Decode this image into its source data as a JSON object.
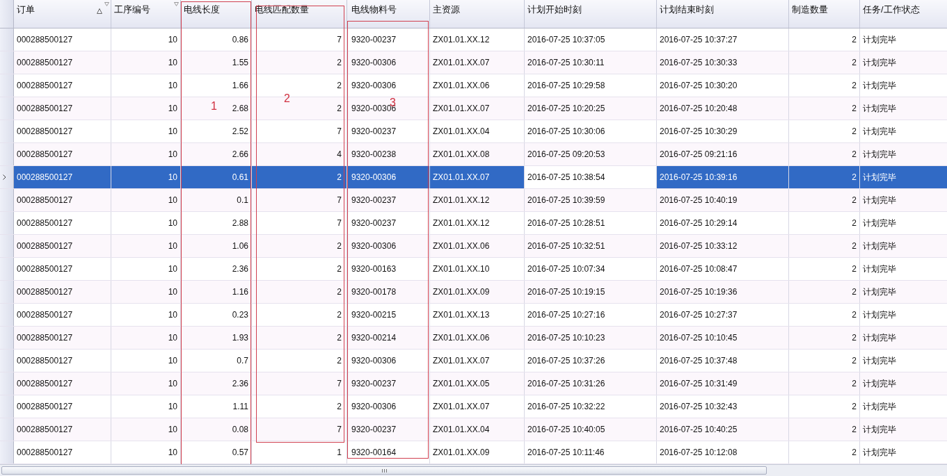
{
  "table": {
    "columns": [
      {
        "label": "订单",
        "kind": "text",
        "sort_ascending": true,
        "filter": true,
        "focused": false
      },
      {
        "label": "工序编号",
        "kind": "number",
        "sort_ascending": false,
        "filter": true,
        "focused": false
      },
      {
        "label": "电线长度",
        "kind": "number",
        "sort_ascending": false,
        "filter": false,
        "focused": false
      },
      {
        "label": "电线匹配数量",
        "kind": "number",
        "sort_ascending": false,
        "filter": false,
        "focused": false
      },
      {
        "label": "电线物料号",
        "kind": "text",
        "sort_ascending": false,
        "filter": false,
        "focused": false
      },
      {
        "label": "主资源",
        "kind": "text",
        "sort_ascending": false,
        "filter": false,
        "focused": false
      },
      {
        "label": "计划开始时刻",
        "kind": "text",
        "sort_ascending": false,
        "filter": false,
        "focused": true
      },
      {
        "label": "计划结束时刻",
        "kind": "text",
        "sort_ascending": false,
        "filter": false,
        "focused": false
      },
      {
        "label": "制造数量",
        "kind": "number",
        "sort_ascending": false,
        "filter": false,
        "focused": false
      },
      {
        "label": "任务/工作状态",
        "kind": "text",
        "sort_ascending": false,
        "filter": false,
        "focused": false
      }
    ],
    "rows": [
      {
        "selected": false,
        "cells": [
          "000288500127",
          "10",
          "0.86",
          "7",
          "9320-00237",
          "ZX01.01.XX.12",
          "2016-07-25 10:37:05",
          "2016-07-25 10:37:27",
          "2",
          "计划完毕"
        ]
      },
      {
        "selected": false,
        "cells": [
          "000288500127",
          "10",
          "1.55",
          "2",
          "9320-00306",
          "ZX01.01.XX.07",
          "2016-07-25 10:30:11",
          "2016-07-25 10:30:33",
          "2",
          "计划完毕"
        ]
      },
      {
        "selected": false,
        "cells": [
          "000288500127",
          "10",
          "1.66",
          "2",
          "9320-00306",
          "ZX01.01.XX.06",
          "2016-07-25 10:29:58",
          "2016-07-25 10:30:20",
          "2",
          "计划完毕"
        ]
      },
      {
        "selected": false,
        "cells": [
          "000288500127",
          "10",
          "2.68",
          "2",
          "9320-00306",
          "ZX01.01.XX.07",
          "2016-07-25 10:20:25",
          "2016-07-25 10:20:48",
          "2",
          "计划完毕"
        ]
      },
      {
        "selected": false,
        "cells": [
          "000288500127",
          "10",
          "2.52",
          "7",
          "9320-00237",
          "ZX01.01.XX.04",
          "2016-07-25 10:30:06",
          "2016-07-25 10:30:29",
          "2",
          "计划完毕"
        ]
      },
      {
        "selected": false,
        "cells": [
          "000288500127",
          "10",
          "2.66",
          "4",
          "9320-00238",
          "ZX01.01.XX.08",
          "2016-07-25 09:20:53",
          "2016-07-25 09:21:16",
          "2",
          "计划完毕"
        ]
      },
      {
        "selected": true,
        "cells": [
          "000288500127",
          "10",
          "0.61",
          "2",
          "9320-00306",
          "ZX01.01.XX.07",
          "2016-07-25 10:38:54",
          "2016-07-25 10:39:16",
          "2",
          "计划完毕"
        ]
      },
      {
        "selected": false,
        "cells": [
          "000288500127",
          "10",
          "0.1",
          "7",
          "9320-00237",
          "ZX01.01.XX.12",
          "2016-07-25 10:39:59",
          "2016-07-25 10:40:19",
          "2",
          "计划完毕"
        ]
      },
      {
        "selected": false,
        "cells": [
          "000288500127",
          "10",
          "2.88",
          "7",
          "9320-00237",
          "ZX01.01.XX.12",
          "2016-07-25 10:28:51",
          "2016-07-25 10:29:14",
          "2",
          "计划完毕"
        ]
      },
      {
        "selected": false,
        "cells": [
          "000288500127",
          "10",
          "1.06",
          "2",
          "9320-00306",
          "ZX01.01.XX.06",
          "2016-07-25 10:32:51",
          "2016-07-25 10:33:12",
          "2",
          "计划完毕"
        ]
      },
      {
        "selected": false,
        "cells": [
          "000288500127",
          "10",
          "2.36",
          "2",
          "9320-00163",
          "ZX01.01.XX.10",
          "2016-07-25 10:07:34",
          "2016-07-25 10:08:47",
          "2",
          "计划完毕"
        ]
      },
      {
        "selected": false,
        "cells": [
          "000288500127",
          "10",
          "1.16",
          "2",
          "9320-00178",
          "ZX01.01.XX.09",
          "2016-07-25 10:19:15",
          "2016-07-25 10:19:36",
          "2",
          "计划完毕"
        ]
      },
      {
        "selected": false,
        "cells": [
          "000288500127",
          "10",
          "0.23",
          "2",
          "9320-00215",
          "ZX01.01.XX.13",
          "2016-07-25 10:27:16",
          "2016-07-25 10:27:37",
          "2",
          "计划完毕"
        ]
      },
      {
        "selected": false,
        "cells": [
          "000288500127",
          "10",
          "1.93",
          "2",
          "9320-00214",
          "ZX01.01.XX.06",
          "2016-07-25 10:10:23",
          "2016-07-25 10:10:45",
          "2",
          "计划完毕"
        ]
      },
      {
        "selected": false,
        "cells": [
          "000288500127",
          "10",
          "0.7",
          "2",
          "9320-00306",
          "ZX01.01.XX.07",
          "2016-07-25 10:37:26",
          "2016-07-25 10:37:48",
          "2",
          "计划完毕"
        ]
      },
      {
        "selected": false,
        "cells": [
          "000288500127",
          "10",
          "2.36",
          "7",
          "9320-00237",
          "ZX01.01.XX.05",
          "2016-07-25 10:31:26",
          "2016-07-25 10:31:49",
          "2",
          "计划完毕"
        ]
      },
      {
        "selected": false,
        "cells": [
          "000288500127",
          "10",
          "1.11",
          "2",
          "9320-00306",
          "ZX01.01.XX.07",
          "2016-07-25 10:32:22",
          "2016-07-25 10:32:43",
          "2",
          "计划完毕"
        ]
      },
      {
        "selected": false,
        "cells": [
          "000288500127",
          "10",
          "0.08",
          "7",
          "9320-00237",
          "ZX01.01.XX.04",
          "2016-07-25 10:40:05",
          "2016-07-25 10:40:25",
          "2",
          "计划完毕"
        ]
      },
      {
        "selected": false,
        "cells": [
          "000288500127",
          "10",
          "0.57",
          "1",
          "9320-00164",
          "ZX01.01.XX.09",
          "2016-07-25 10:11:46",
          "2016-07-25 10:12:08",
          "2",
          "计划完毕"
        ]
      }
    ]
  },
  "annotations": [
    {
      "label": "1"
    },
    {
      "label": "2"
    },
    {
      "label": "3"
    }
  ]
}
